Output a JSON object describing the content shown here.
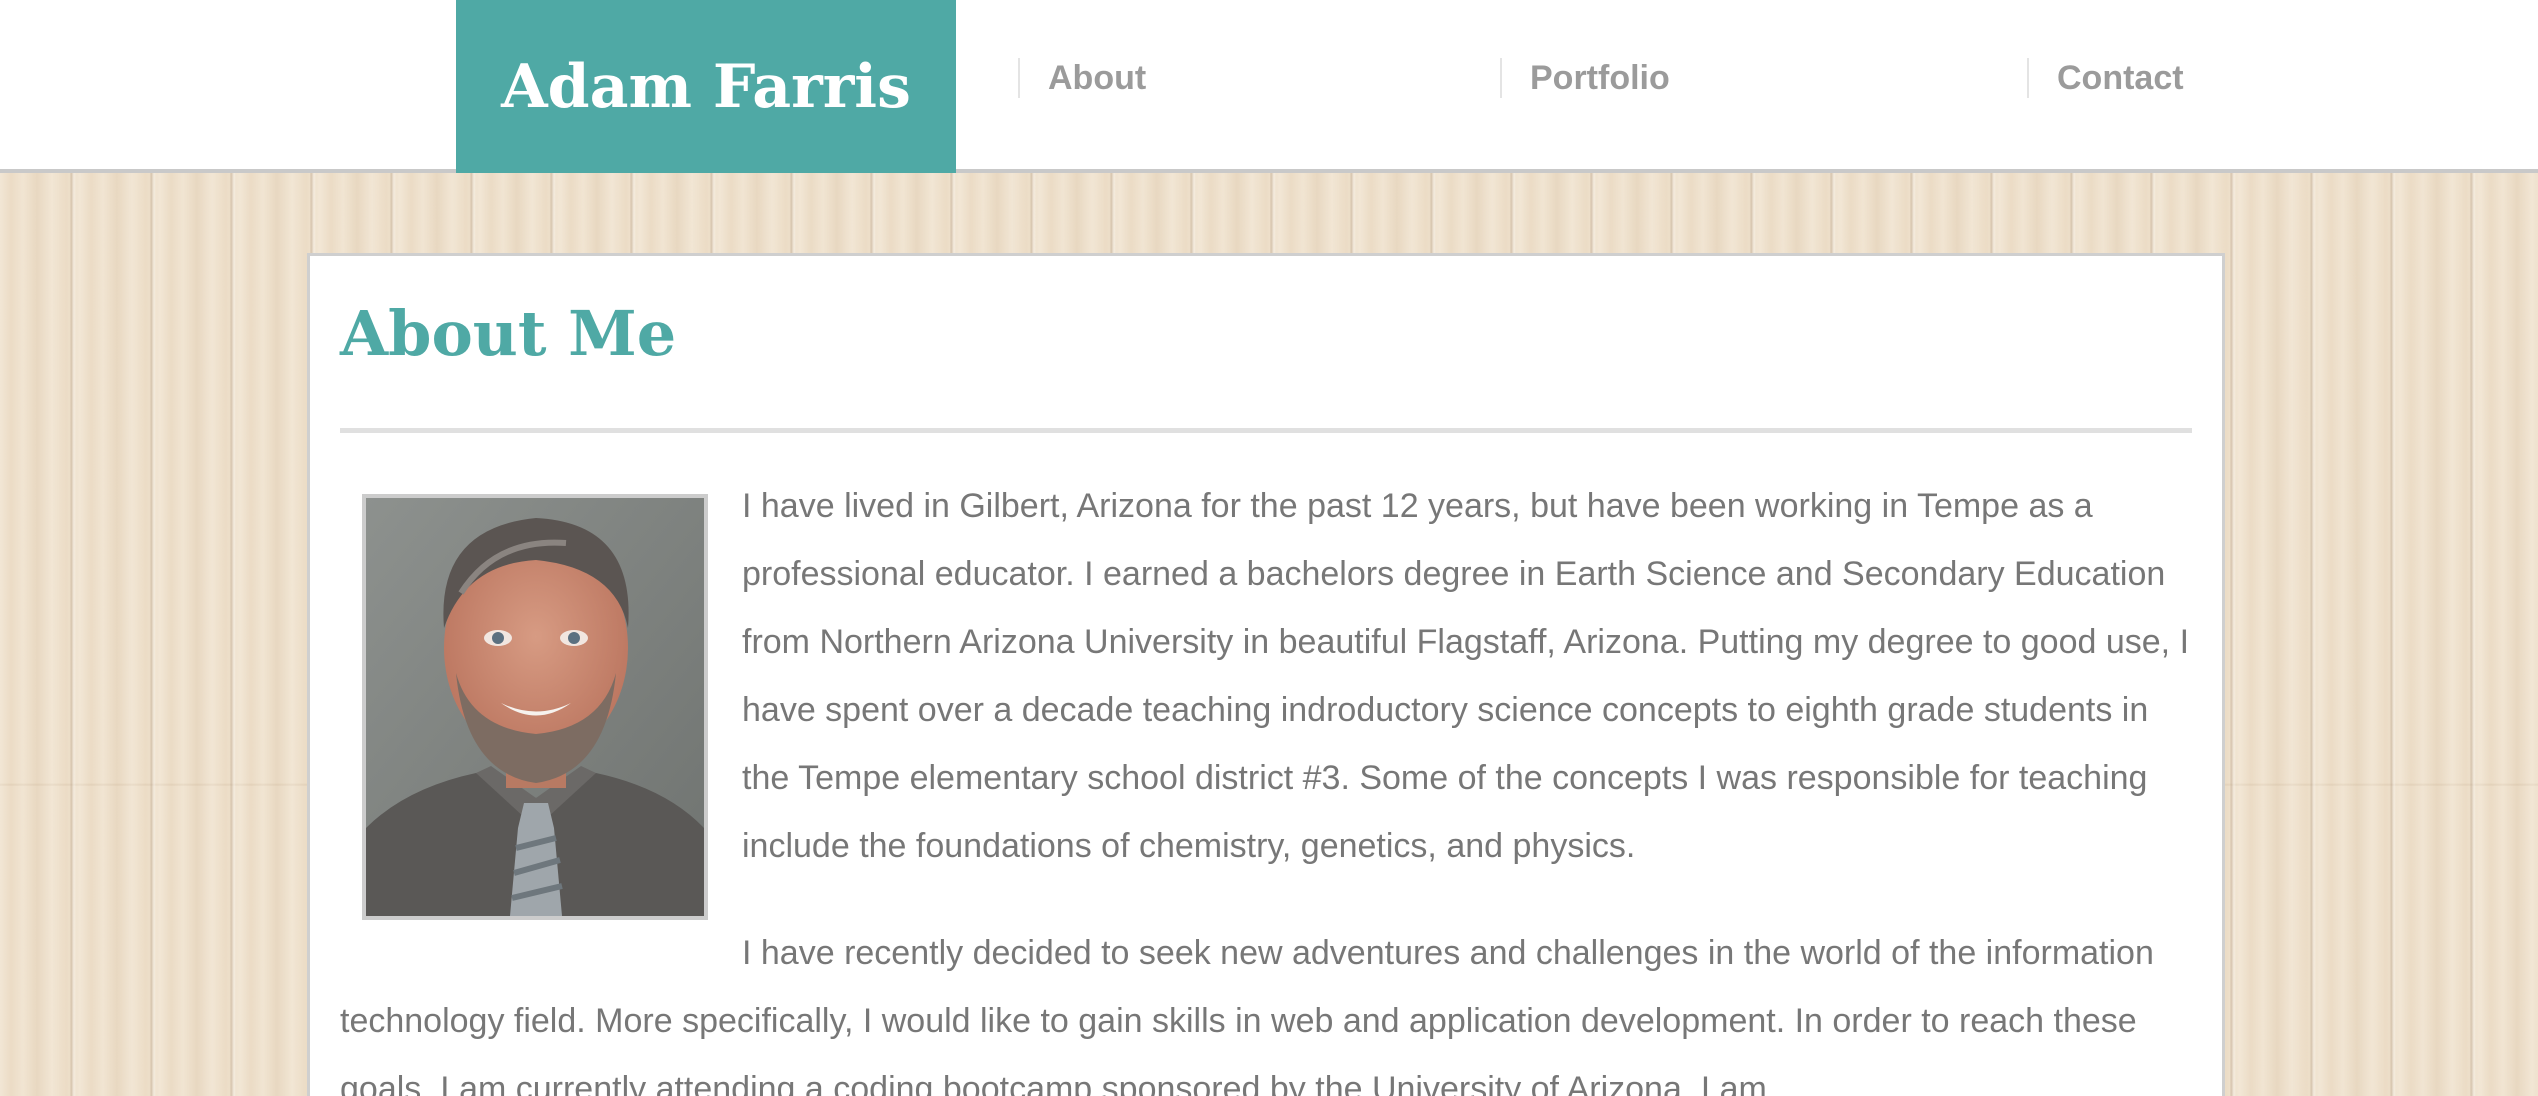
{
  "header": {
    "brand": "Adam Farris",
    "nav": {
      "about": "About",
      "portfolio": "Portfolio",
      "contact": "Contact"
    }
  },
  "main": {
    "title": "About Me",
    "portrait_icon": "person-photo",
    "paragraphs": {
      "p1": "I have lived in Gilbert, Arizona for the past 12 years, but have been working in Tempe as a professional educator. I earned a bachelors degree in Earth Science and Secondary Education from Northern Arizona University in beautiful Flagstaff, Arizona. Putting my degree to good use, I have spent over a decade teaching indroductory science concepts to eighth grade students in the Tempe elementary school district #3. Some of the concepts I was responsible for teaching include the foundations of chemistry, genetics, and physics.",
      "p2": "I have recently decided to seek new adventures and challenges in the world of the information technology field. More specifically, I would like to gain skills in web and application development. In order to reach these goals, I am currently attending a coding bootcamp sponsored by the University of Arizona. I am"
    }
  },
  "colors": {
    "accent": "#4fa9a5",
    "nav_text": "#9b9b9b",
    "body_text": "#777777"
  }
}
